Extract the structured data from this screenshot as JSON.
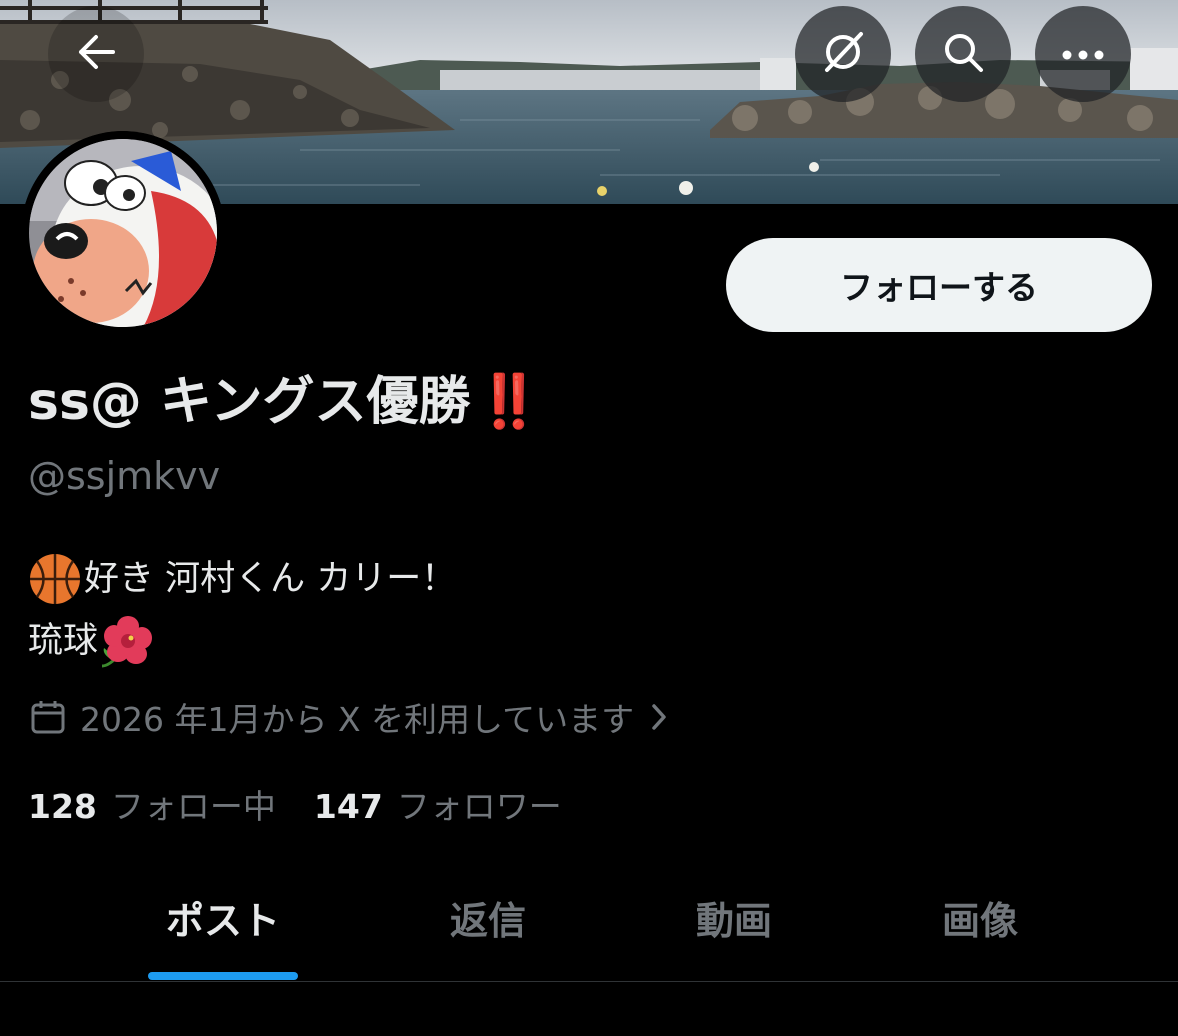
{
  "header": {
    "back_icon": "arrow-left-icon",
    "grok_icon": "grok-icon",
    "search_icon": "search-icon",
    "more_icon": "more-horizontal-icon"
  },
  "profile": {
    "follow_label": "フォローする",
    "display_name": "ss@ キングス優勝",
    "display_name_emoji": "‼️",
    "handle": "@ssjmkvv",
    "bio_line1": "好き 河村くん カリー！",
    "bio_line2": "琉球",
    "joined": "2026 年1月から X を利用しています",
    "following_count": "128",
    "following_label": "フォロー中",
    "followers_count": "147",
    "followers_label": "フォロワー"
  },
  "tabs": [
    {
      "label": "ポスト",
      "active": true
    },
    {
      "label": "返信",
      "active": false
    },
    {
      "label": "動画",
      "active": false
    },
    {
      "label": "画像",
      "active": false
    }
  ],
  "colors": {
    "background": "#000000",
    "text_primary": "#e7e9ea",
    "text_secondary": "#71767b",
    "accent": "#1d9bf0",
    "follow_button_bg": "#eff3f4",
    "emoji_red": "#e0301e"
  }
}
